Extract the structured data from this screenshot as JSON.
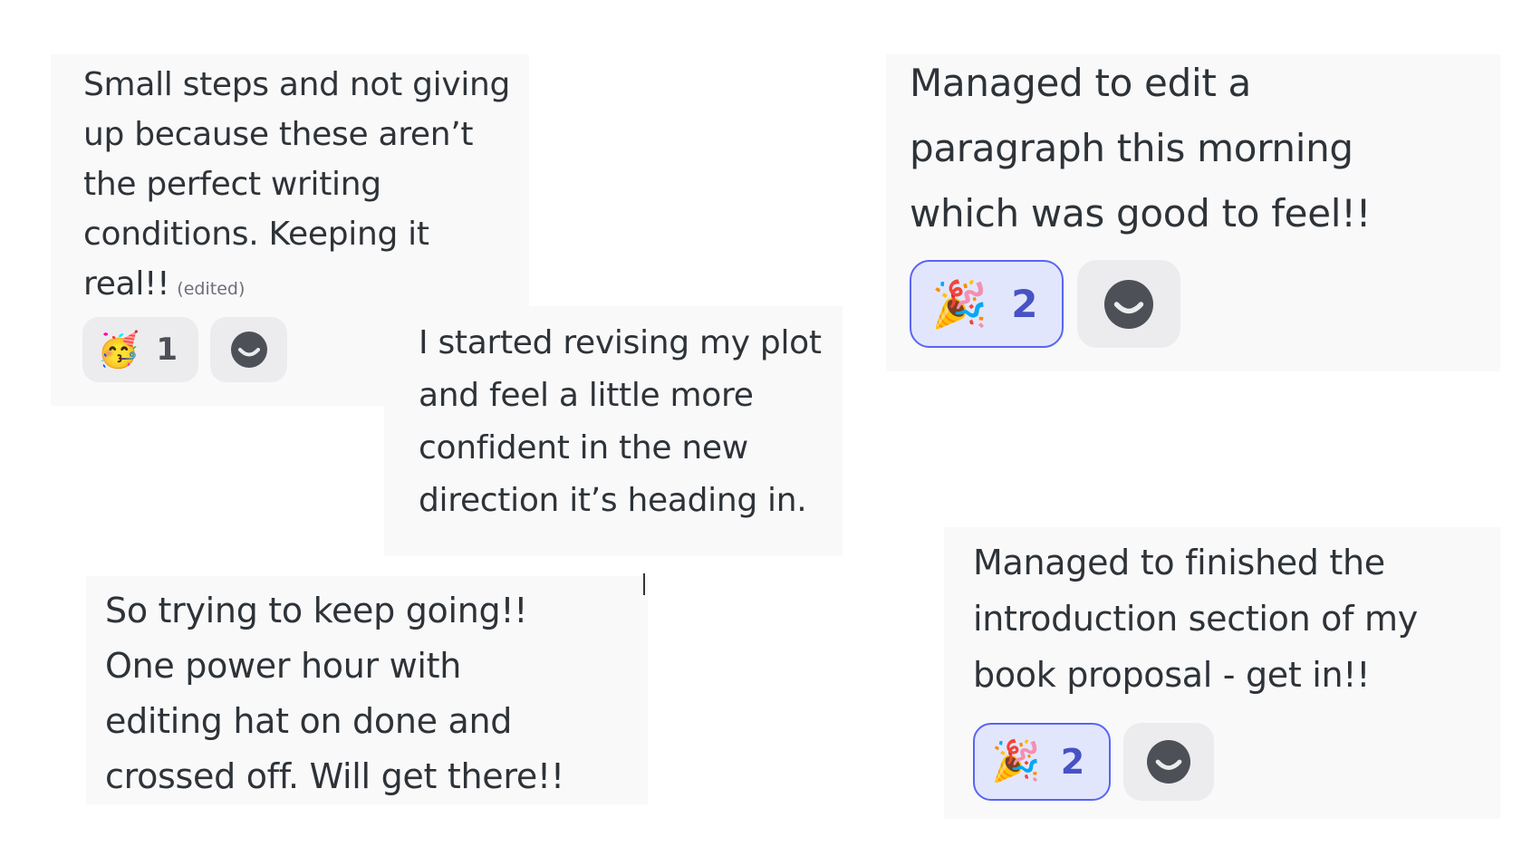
{
  "messages": [
    {
      "lines": [
        "Small steps and not giving",
        "up because these aren’t",
        "the perfect writing",
        "conditions. Keeping it",
        "real!!"
      ],
      "edited_tag": "(edited)",
      "reaction": {
        "emoji": "🥳",
        "emoji_name": "partying-face",
        "count": "1",
        "reacted_by_me": false
      },
      "add_reaction_icon": "smiley-add-reaction-icon"
    },
    {
      "lines": [
        "I started revising my plot",
        "and feel a little more",
        "confident in the new",
        "direction it’s heading in."
      ]
    },
    {
      "lines": [
        "So trying to keep going!!",
        "One power hour with",
        "editing hat on done and",
        "crossed off. Will get there!!"
      ]
    },
    {
      "lines": [
        "Managed to edit a",
        "paragraph this morning",
        "which was good to feel!!"
      ],
      "reaction": {
        "emoji": "🎉",
        "emoji_name": "party-popper",
        "count": "2",
        "reacted_by_me": true
      },
      "add_reaction_icon": "smiley-add-reaction-icon"
    },
    {
      "lines": [
        "Managed to finished the",
        "introduction section of my",
        "book proposal - get in!!"
      ],
      "reaction": {
        "emoji": "🎉",
        "emoji_name": "party-popper",
        "count": "2",
        "reacted_by_me": true
      },
      "add_reaction_icon": "smiley-add-reaction-icon"
    }
  ],
  "colors": {
    "card_bg": "#f9f9fa",
    "text": "#2e3338",
    "reaction_bg": "#ececee",
    "reaction_me_bg": "#e2e6fd",
    "reaction_me_border": "#5865f2",
    "icon": "#4e5058"
  }
}
